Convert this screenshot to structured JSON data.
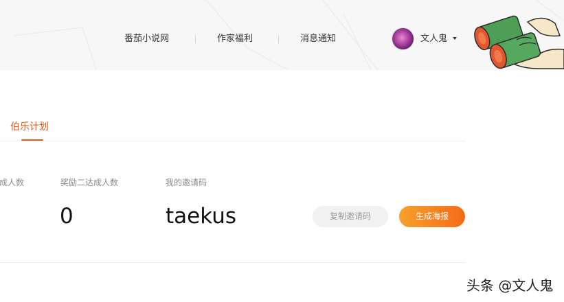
{
  "header": {
    "nav": [
      {
        "label": "番茄小说网"
      },
      {
        "label": "作家福利"
      },
      {
        "label": "消息通知"
      }
    ],
    "user": {
      "name": "文人鬼"
    }
  },
  "tabs": [
    {
      "label": "伯乐计划",
      "active": true
    }
  ],
  "stats": [
    {
      "label": "成人数",
      "value": ""
    },
    {
      "label": "奖励二达成人数",
      "value": "0"
    },
    {
      "label": "我的邀请码",
      "value": "taekus"
    }
  ],
  "buttons": {
    "copy_code": "复制邀请码",
    "generate_poster": "生成海报"
  },
  "watermark": "头条 @文人鬼",
  "colors": {
    "accent": "#e05a18",
    "poster_gradient_start": "#f7a12c",
    "poster_gradient_end": "#f26a18"
  }
}
